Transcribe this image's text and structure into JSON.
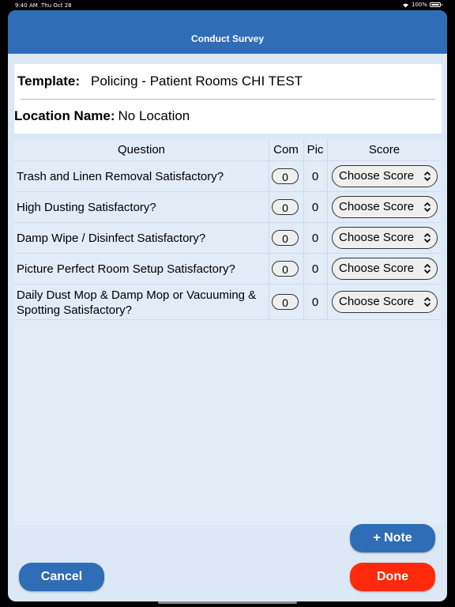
{
  "status_bar": {
    "time": "9:40 AM",
    "date": "Thu Oct 28",
    "battery": "100%"
  },
  "navbar": {
    "title": "Conduct Survey"
  },
  "info": {
    "template_label": "Template:",
    "template_value": "Policing - Patient Rooms CHI TEST",
    "location_label": "Location Name:",
    "location_value": "No Location"
  },
  "table": {
    "headers": {
      "question": "Question",
      "com": "Com",
      "pic": "Pic",
      "score": "Score"
    },
    "rows": [
      {
        "question": "Trash and Linen Removal Satisfactory?",
        "com": "0",
        "pic": "0",
        "score": "Choose Score"
      },
      {
        "question": "High Dusting Satisfactory?",
        "com": "0",
        "pic": "0",
        "score": "Choose Score"
      },
      {
        "question": "Damp Wipe / Disinfect Satisfactory?",
        "com": "0",
        "pic": "0",
        "score": "Choose Score"
      },
      {
        "question": "Picture Perfect Room Setup Satisfactory?",
        "com": "0",
        "pic": "0",
        "score": "Choose Score"
      },
      {
        "question": "Daily Dust Mop & Damp Mop or Vacuuming & Spotting Satisfactory?",
        "com": "0",
        "pic": "0",
        "score": "Choose Score"
      }
    ]
  },
  "buttons": {
    "note": "+ Note",
    "cancel": "Cancel",
    "done": "Done"
  },
  "colors": {
    "primary": "#2f6db7",
    "done": "#ff2a0c",
    "background": "#dce8f5"
  },
  "icons": {
    "wifi": "wifi-icon",
    "battery": "battery-icon",
    "chevron": "chevron-up-down-icon"
  }
}
